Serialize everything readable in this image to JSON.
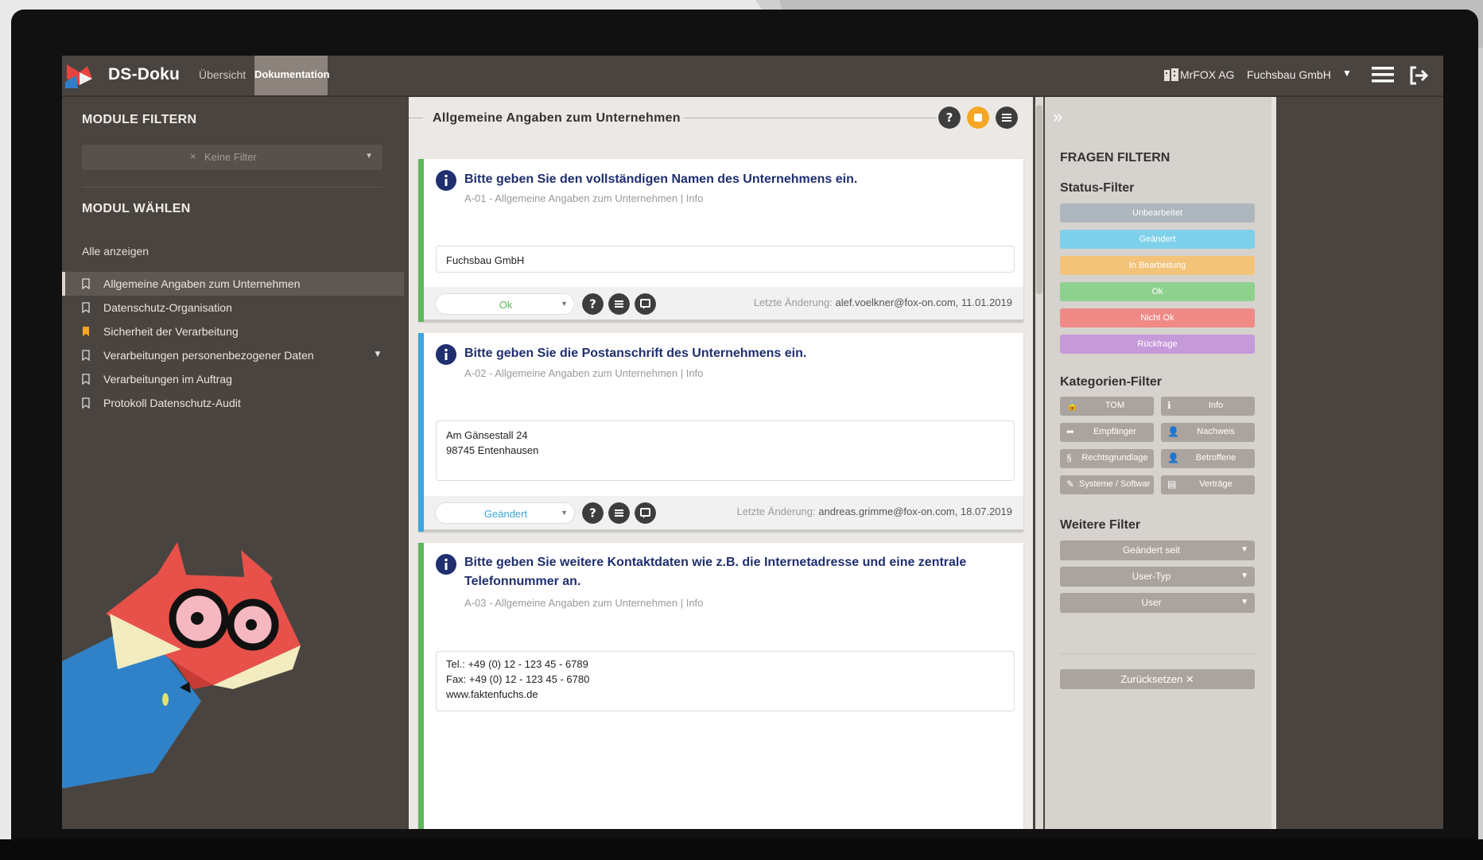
{
  "app": {
    "name": "DS-Doku"
  },
  "tabs": [
    {
      "label": "Übersicht",
      "active": false
    },
    {
      "label": "Dokumentation",
      "active": true
    }
  ],
  "header": {
    "company": "MrFOX AG",
    "client": "Fuchsbau GmbH",
    "client_caret": "▼",
    "menu_icon": "hamburger-menu-icon",
    "logout_icon": "logout-icon"
  },
  "sidebar": {
    "filter_heading": "MODULE FILTERN",
    "filter_placeholder": "Keine Filter",
    "filter_clear": "×",
    "choose_heading": "MODUL WÄHLEN",
    "show_all": "Alle anzeigen",
    "modules": [
      {
        "label": "Allgemeine Angaben zum Unternehmen",
        "active": true,
        "bookmark": "outline"
      },
      {
        "label": "Datenschutz-Organisation",
        "active": false,
        "bookmark": "outline"
      },
      {
        "label": "Sicherheit der Verarbeitung",
        "active": false,
        "bookmark": "filled-orange"
      },
      {
        "label": "Verarbeitungen personenbezogener Daten",
        "active": false,
        "bookmark": "outline",
        "expandable": true
      },
      {
        "label": "Verarbeitungen im Auftrag",
        "active": false,
        "bookmark": "outline"
      },
      {
        "label": "Protokoll Datenschutz-Audit",
        "active": false,
        "bookmark": "outline"
      }
    ]
  },
  "main": {
    "title": "Allgemeine Angaben zum Unternehmen",
    "header_icons": [
      "help-icon",
      "orange-action-icon",
      "list-icon"
    ],
    "questions": [
      {
        "question": "Bitte geben Sie den vollständigen Namen des Unternehmens ein.",
        "meta": "A-01 - Allgemeine Angaben zum Unternehmen | Info",
        "answer": "Fuchsbau GmbH",
        "status": "Ok",
        "status_color": "#5cb85c",
        "bar_color": "#5cb85c",
        "last_change_label": "Letzte Änderung:",
        "last_change": "alef.voelkner@fox-on.com, 11.01.2019"
      },
      {
        "question": "Bitte geben Sie die Postanschrift des Unternehmens ein.",
        "meta": "A-02 - Allgemeine Angaben zum Unternehmen | Info",
        "answer_lines": [
          "Am Gänsestall 24",
          "98745 Entenhausen"
        ],
        "status": "Geändert",
        "status_color": "#3aa7d8",
        "bar_color": "#3aa7e0",
        "last_change_label": "Letzte Änderung:",
        "last_change": "andreas.grimme@fox-on.com, 18.07.2019"
      },
      {
        "question": "Bitte geben Sie weitere Kontaktdaten wie z.B. die Internetadresse und eine zentrale Telefonnummer an.",
        "meta": "A-03 - Allgemeine Angaben zum Unternehmen | Info",
        "answer_lines": [
          "Tel.: +49 (0) 12 - 123 45 - 6789",
          "Fax: +49 (0) 12 - 123 45 - 6780",
          "www.faktenfuchs.de"
        ],
        "bar_color": "#5cb85c"
      }
    ]
  },
  "right_panel": {
    "collapse_icon": "»",
    "heading": "FRAGEN FILTERN",
    "status_heading": "Status-Filter",
    "status_filters": [
      {
        "label": "Unbearbeitet",
        "color": "#aeb6bd"
      },
      {
        "label": "Geändert",
        "color": "#7fd0ea"
      },
      {
        "label": "In Bearbeitung",
        "color": "#f3c37a"
      },
      {
        "label": "Ok",
        "color": "#8ed08e"
      },
      {
        "label": "Nicht Ok",
        "color": "#ef8a86"
      },
      {
        "label": "Rückfrage",
        "color": "#c699d9"
      }
    ],
    "category_heading": "Kategorien-Filter",
    "categories": [
      {
        "label": "TOM",
        "icon": "lock-icon",
        "glyph": "🔒"
      },
      {
        "label": "Info",
        "icon": "info-icon",
        "glyph": "ℹ"
      },
      {
        "label": "Empfänger",
        "icon": "share-icon",
        "glyph": "➦"
      },
      {
        "label": "Nachweis",
        "icon": "user-icon",
        "glyph": "👤"
      },
      {
        "label": "Rechtsgrundlage",
        "icon": "paragraph-icon",
        "glyph": "§"
      },
      {
        "label": "Betroffene",
        "icon": "person-icon",
        "glyph": "👤"
      },
      {
        "label": "Systeme / Software",
        "icon": "wrench-icon",
        "glyph": "✎"
      },
      {
        "label": "Verträge",
        "icon": "document-icon",
        "glyph": "▤"
      }
    ],
    "more_heading": "Weitere Filter",
    "more_filters": [
      "Geändert seit",
      "User-Typ",
      "User"
    ],
    "reset": "Zurücksetzen ✕"
  }
}
